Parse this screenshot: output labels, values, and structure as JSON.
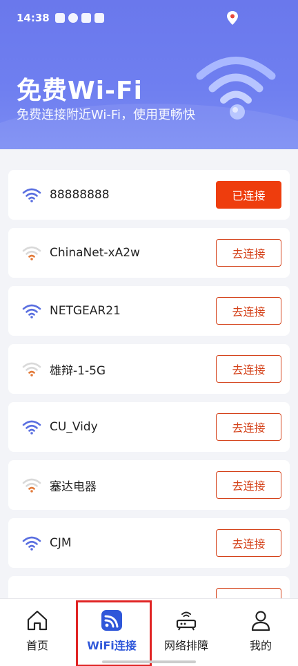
{
  "status_bar": {
    "time": "14:38"
  },
  "header": {
    "title": "免费Wi-Fi",
    "subtitle": "免费连接附近Wi-Fi，使用更畅快"
  },
  "networks": [
    {
      "name": "88888888",
      "button": "已连接",
      "status": "connected",
      "signal_color": "#5a6fe0"
    },
    {
      "name": "ChinaNet-xA2w",
      "button": "去连接",
      "status": "available",
      "signal_color": "#e27a3a"
    },
    {
      "name": "NETGEAR21",
      "button": "去连接",
      "status": "available",
      "signal_color": "#5a6fe0"
    },
    {
      "name": "雄辩-1-5G",
      "button": "去连接",
      "status": "available",
      "signal_color": "#e27a3a"
    },
    {
      "name": "CU_Vidy",
      "button": "去连接",
      "status": "available",
      "signal_color": "#5a6fe0"
    },
    {
      "name": "塞达电器",
      "button": "去连接",
      "status": "available",
      "signal_color": "#e27a3a"
    },
    {
      "name": "CJM",
      "button": "去连接",
      "status": "available",
      "signal_color": "#5a6fe0"
    }
  ],
  "tabs": [
    {
      "label": "首页",
      "icon": "home-icon",
      "active": false
    },
    {
      "label": "WiFi连接",
      "icon": "wifi-icon",
      "active": true
    },
    {
      "label": "网络排障",
      "icon": "router-icon",
      "active": false
    },
    {
      "label": "我的",
      "icon": "user-icon",
      "active": false
    }
  ],
  "colors": {
    "header": "#6f7ff0",
    "accent_red": "#ee3d0d",
    "active_tab": "#2f57d9",
    "highlight_box": "#e02424"
  }
}
